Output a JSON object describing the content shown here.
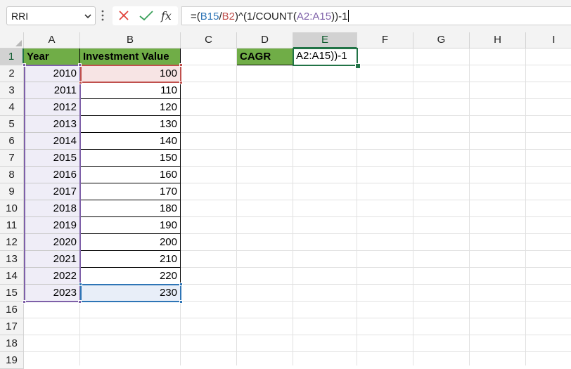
{
  "name_box": {
    "value": "RRI"
  },
  "formula": {
    "parts": {
      "p1": "=(",
      "p2": "B15",
      "p3": "/",
      "p4": "B2",
      "p5": ")^(1/COUNT(",
      "p6": "A2:A15",
      "p7": "))-1"
    }
  },
  "icons": {
    "cancel": "close-icon",
    "enter": "check-icon",
    "function": "fx-icon",
    "dropdown": "chevron-down-icon"
  },
  "colors": {
    "accent": "#217346",
    "header_fill": "#70ad47",
    "ref_blue": "#2e75b6",
    "ref_red": "#c0504d",
    "ref_purple": "#7e60a8"
  },
  "columns": [
    "A",
    "B",
    "C",
    "D",
    "E",
    "F",
    "G",
    "H",
    "I"
  ],
  "rows": [
    "1",
    "2",
    "3",
    "4",
    "5",
    "6",
    "7",
    "8",
    "9",
    "10",
    "11",
    "12",
    "13",
    "14",
    "15",
    "16",
    "17",
    "18",
    "19"
  ],
  "table": {
    "header_year": "Year",
    "header_value": "Investment Value",
    "years": [
      "2010",
      "2011",
      "2012",
      "2013",
      "2014",
      "2015",
      "2016",
      "2017",
      "2018",
      "2019",
      "2020",
      "2021",
      "2022",
      "2023"
    ],
    "values": [
      "100",
      "110",
      "120",
      "130",
      "140",
      "150",
      "160",
      "170",
      "180",
      "190",
      "200",
      "210",
      "220",
      "230"
    ]
  },
  "cagr": {
    "label": "CAGR",
    "edit_text": "A2:A15))-1"
  },
  "selection": {
    "active_column": "E",
    "active_row": "1"
  }
}
